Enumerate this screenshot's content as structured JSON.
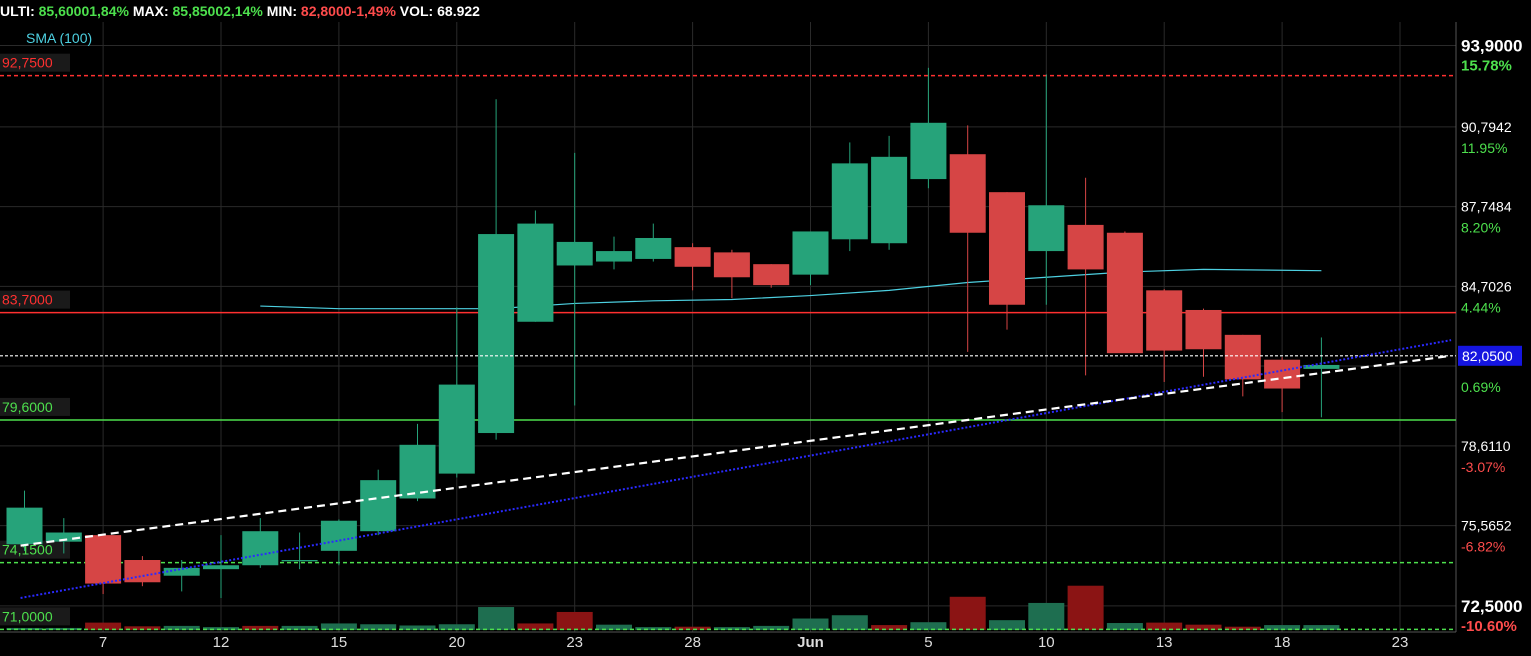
{
  "header": {
    "last_label": "ULTI:",
    "last_value": "85,6000",
    "last_change": "1,84%",
    "max_label": "MAX:",
    "max_value": "85,8500",
    "max_change": "2,14%",
    "min_label": "MIN:",
    "min_value": "82,8000",
    "min_change": "-1,49%",
    "vol_label": "VOL:",
    "vol_value": "68.922"
  },
  "indicator_label": "SMA (100)",
  "colors": {
    "up": "#26a37a",
    "down": "#d64545",
    "sma": "#4dd0e1",
    "trend_white": "#ffffff",
    "trend_blue": "#2a2aff",
    "resistance": "#ff3030",
    "support": "#4de04d",
    "grid": "#2a2a2a"
  },
  "chart_data": {
    "type": "candlestick",
    "y_range": [
      71.5,
      94.8
    ],
    "x_ticks": [
      {
        "idx": 2,
        "label": "7"
      },
      {
        "idx": 5,
        "label": "12"
      },
      {
        "idx": 8,
        "label": "15"
      },
      {
        "idx": 11,
        "label": "20"
      },
      {
        "idx": 14,
        "label": "23"
      },
      {
        "idx": 17,
        "label": "28"
      },
      {
        "idx": 20,
        "label": "Jun"
      },
      {
        "idx": 23,
        "label": "5"
      },
      {
        "idx": 26,
        "label": "10"
      },
      {
        "idx": 29,
        "label": "13"
      },
      {
        "idx": 32,
        "label": "18"
      },
      {
        "idx": 35,
        "label": "23"
      }
    ],
    "price_axis": [
      {
        "price": "93,9000",
        "pct": "15.78%",
        "pct_color": "#4de04d",
        "bold": true,
        "y": 93.9
      },
      {
        "price": "90,7942",
        "pct": "11.95%",
        "pct_color": "#4de04d",
        "bold": false,
        "y": 90.7942
      },
      {
        "price": "87,7484",
        "pct": "8.20%",
        "pct_color": "#4de04d",
        "bold": false,
        "y": 87.7484
      },
      {
        "price": "84,7026",
        "pct": "4.44%",
        "pct_color": "#4de04d",
        "bold": false,
        "y": 84.7026
      },
      {
        "price": "",
        "pct": "0.69%",
        "pct_color": "#4de04d",
        "bold": false,
        "y": 81.66
      },
      {
        "price": "78,6110",
        "pct": "-3.07%",
        "pct_color": "#ff4c4c",
        "bold": false,
        "y": 78.611
      },
      {
        "price": "75,5652",
        "pct": "-6.82%",
        "pct_color": "#ff4c4c",
        "bold": false,
        "y": 75.5652
      },
      {
        "price": "72,5000",
        "pct": "-10.60%",
        "pct_color": "#ff4c4c",
        "bold": true,
        "y": 72.5
      }
    ],
    "current_price": {
      "label": "82,0500",
      "value": 82.05
    },
    "levels": [
      {
        "label": "92,7500",
        "value": 92.75,
        "style": "dashed",
        "color": "#ff3030"
      },
      {
        "label": "83,7000",
        "value": 83.7,
        "style": "solid",
        "color": "#ff3030"
      },
      {
        "label": "79,6000",
        "value": 79.6,
        "style": "solid",
        "color": "#4de04d"
      },
      {
        "label": "74,1500",
        "value": 74.15,
        "style": "dashed",
        "color": "#4de04d"
      },
      {
        "label": "71,0000",
        "value": 71.6,
        "style": "dashed",
        "color": "#4de04d"
      }
    ],
    "candles": [
      {
        "o": 74.85,
        "h": 76.9,
        "l": 74.6,
        "c": 76.25
      },
      {
        "o": 74.95,
        "h": 75.85,
        "l": 74.5,
        "c": 75.3
      },
      {
        "o": 75.2,
        "h": 75.25,
        "l": 72.95,
        "c": 73.35
      },
      {
        "o": 74.25,
        "h": 74.4,
        "l": 73.25,
        "c": 73.4
      },
      {
        "o": 73.65,
        "h": 74.25,
        "l": 73.05,
        "c": 73.95
      },
      {
        "o": 73.9,
        "h": 75.2,
        "l": 72.8,
        "c": 74.05
      },
      {
        "o": 74.05,
        "h": 75.85,
        "l": 73.95,
        "c": 75.35
      },
      {
        "o": 74.2,
        "h": 75.3,
        "l": 73.9,
        "c": 74.25
      },
      {
        "o": 74.6,
        "h": 75.8,
        "l": 74.05,
        "c": 75.75
      },
      {
        "o": 75.35,
        "h": 77.7,
        "l": 75.2,
        "c": 77.3
      },
      {
        "o": 76.6,
        "h": 79.45,
        "l": 76.5,
        "c": 78.65
      },
      {
        "o": 77.55,
        "h": 83.9,
        "l": 77.4,
        "c": 80.95
      },
      {
        "o": 79.1,
        "h": 91.85,
        "l": 78.85,
        "c": 86.7
      },
      {
        "o": 83.35,
        "h": 87.6,
        "l": 83.35,
        "c": 87.1
      },
      {
        "o": 85.5,
        "h": 89.8,
        "l": 80.15,
        "c": 86.4
      },
      {
        "o": 85.65,
        "h": 86.6,
        "l": 85.35,
        "c": 86.05
      },
      {
        "o": 85.75,
        "h": 87.1,
        "l": 85.65,
        "c": 86.55
      },
      {
        "o": 86.2,
        "h": 86.35,
        "l": 84.55,
        "c": 85.45
      },
      {
        "o": 86.0,
        "h": 86.1,
        "l": 84.25,
        "c": 85.05
      },
      {
        "o": 85.55,
        "h": 85.55,
        "l": 84.65,
        "c": 84.75
      },
      {
        "o": 85.15,
        "h": 86.6,
        "l": 84.75,
        "c": 86.8
      },
      {
        "o": 86.5,
        "h": 90.2,
        "l": 86.05,
        "c": 89.4
      },
      {
        "o": 86.35,
        "h": 90.45,
        "l": 86.1,
        "c": 89.65
      },
      {
        "o": 88.8,
        "h": 93.05,
        "l": 88.45,
        "c": 90.95
      },
      {
        "o": 89.75,
        "h": 90.85,
        "l": 82.2,
        "c": 86.75
      },
      {
        "o": 88.3,
        "h": 88.3,
        "l": 83.05,
        "c": 84.0
      },
      {
        "o": 86.05,
        "h": 92.8,
        "l": 84.0,
        "c": 87.8
      },
      {
        "o": 87.05,
        "h": 88.85,
        "l": 81.3,
        "c": 85.35
      },
      {
        "o": 86.75,
        "h": 86.8,
        "l": 82.95,
        "c": 82.15
      },
      {
        "o": 84.55,
        "h": 84.6,
        "l": 81.05,
        "c": 82.25
      },
      {
        "o": 83.8,
        "h": 83.85,
        "l": 81.25,
        "c": 82.3
      },
      {
        "o": 82.85,
        "h": 82.85,
        "l": 80.5,
        "c": 81.15
      },
      {
        "o": 81.9,
        "h": 82.0,
        "l": 79.9,
        "c": 80.8
      },
      {
        "o": 81.55,
        "h": 82.75,
        "l": 79.7,
        "c": 81.7
      }
    ],
    "volumes": [
      {
        "v": 1.0,
        "up": true
      },
      {
        "v": 1.0,
        "up": true
      },
      {
        "v": 3.6,
        "up": false
      },
      {
        "v": 1.8,
        "up": false
      },
      {
        "v": 2.0,
        "up": true
      },
      {
        "v": 1.4,
        "up": true
      },
      {
        "v": 2.0,
        "up": false
      },
      {
        "v": 2.0,
        "up": true
      },
      {
        "v": 3.2,
        "up": true
      },
      {
        "v": 2.8,
        "up": true
      },
      {
        "v": 2.2,
        "up": true
      },
      {
        "v": 2.8,
        "up": true
      },
      {
        "v": 11.2,
        "up": true
      },
      {
        "v": 3.2,
        "up": false
      },
      {
        "v": 8.8,
        "up": false
      },
      {
        "v": 2.6,
        "up": true
      },
      {
        "v": 1.4,
        "up": true
      },
      {
        "v": 1.6,
        "up": false
      },
      {
        "v": 1.4,
        "up": true
      },
      {
        "v": 2.0,
        "up": true
      },
      {
        "v": 5.6,
        "up": true
      },
      {
        "v": 7.2,
        "up": true
      },
      {
        "v": 2.4,
        "up": false
      },
      {
        "v": 3.8,
        "up": true
      },
      {
        "v": 16.2,
        "up": false
      },
      {
        "v": 4.8,
        "up": true
      },
      {
        "v": 13.2,
        "up": true
      },
      {
        "v": 21.6,
        "up": false
      },
      {
        "v": 3.4,
        "up": true
      },
      {
        "v": 3.6,
        "up": false
      },
      {
        "v": 2.6,
        "up": false
      },
      {
        "v": 1.6,
        "up": false
      },
      {
        "v": 2.4,
        "up": true
      },
      {
        "v": 2.4,
        "up": true
      }
    ],
    "sma_100": [
      {
        "idx": 6,
        "v": 83.95
      },
      {
        "idx": 8,
        "v": 83.85
      },
      {
        "idx": 12,
        "v": 83.85
      },
      {
        "idx": 14,
        "v": 84.05
      },
      {
        "idx": 16,
        "v": 84.15
      },
      {
        "idx": 18,
        "v": 84.2
      },
      {
        "idx": 20,
        "v": 84.35
      },
      {
        "idx": 22,
        "v": 84.55
      },
      {
        "idx": 24,
        "v": 84.85
      },
      {
        "idx": 26,
        "v": 85.05
      },
      {
        "idx": 28,
        "v": 85.25
      },
      {
        "idx": 30,
        "v": 85.35
      },
      {
        "idx": 33,
        "v": 85.3
      }
    ],
    "trend_white": [
      {
        "idx": -0.1,
        "v": 74.8
      },
      {
        "idx": 36.3,
        "v": 82.05
      }
    ],
    "trend_blue": [
      {
        "idx": -0.1,
        "v": 72.8
      },
      {
        "idx": 36.3,
        "v": 82.65
      }
    ]
  }
}
